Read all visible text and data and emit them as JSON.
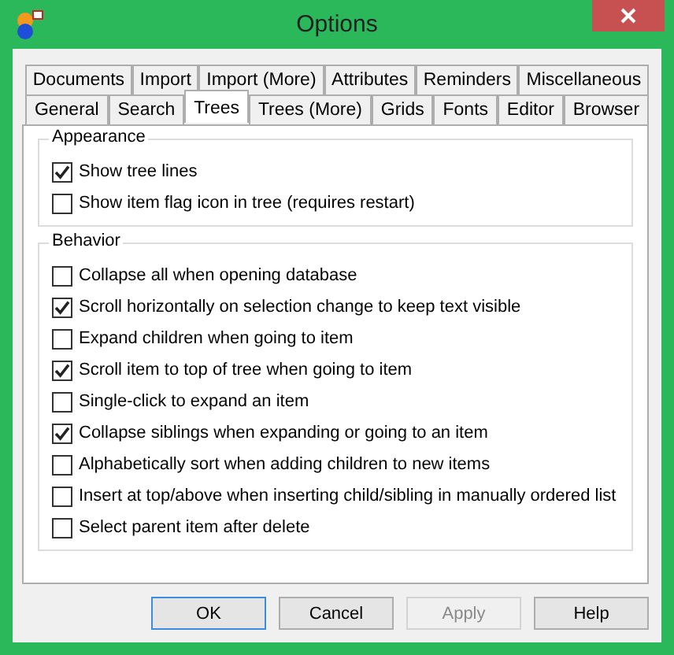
{
  "window": {
    "title": "Options"
  },
  "tab_rows": [
    [
      {
        "label": "Documents",
        "selected": false
      },
      {
        "label": "Import",
        "selected": false
      },
      {
        "label": "Import (More)",
        "selected": false
      },
      {
        "label": "Attributes",
        "selected": false
      },
      {
        "label": "Reminders",
        "selected": false
      },
      {
        "label": "Miscellaneous",
        "selected": false
      }
    ],
    [
      {
        "label": "General",
        "selected": false
      },
      {
        "label": "Search",
        "selected": false
      },
      {
        "label": "Trees",
        "selected": true
      },
      {
        "label": "Trees (More)",
        "selected": false
      },
      {
        "label": "Grids",
        "selected": false
      },
      {
        "label": "Fonts",
        "selected": false
      },
      {
        "label": "Editor",
        "selected": false
      },
      {
        "label": "Browser",
        "selected": false
      }
    ]
  ],
  "groups": [
    {
      "title": "Appearance",
      "options": [
        {
          "label": "Show tree lines",
          "checked": true
        },
        {
          "label": "Show item flag icon in tree (requires restart)",
          "checked": false
        }
      ]
    },
    {
      "title": "Behavior",
      "options": [
        {
          "label": "Collapse all when opening database",
          "checked": false
        },
        {
          "label": "Scroll horizontally on selection change to keep text visible",
          "checked": true
        },
        {
          "label": "Expand children when going to item",
          "checked": false
        },
        {
          "label": "Scroll item to top of tree when going to item",
          "checked": true
        },
        {
          "label": "Single-click to expand an item",
          "checked": false
        },
        {
          "label": "Collapse siblings when expanding or going to an item",
          "checked": true
        },
        {
          "label": "Alphabetically sort when adding children to new items",
          "checked": false
        },
        {
          "label": "Insert at top/above when inserting child/sibling in manually ordered list",
          "checked": false
        },
        {
          "label": "Select parent item after delete",
          "checked": false
        }
      ]
    }
  ],
  "buttons": [
    {
      "label": "OK",
      "default": true,
      "disabled": false
    },
    {
      "label": "Cancel",
      "default": false,
      "disabled": false
    },
    {
      "label": "Apply",
      "default": false,
      "disabled": true
    },
    {
      "label": "Help",
      "default": false,
      "disabled": false
    }
  ]
}
